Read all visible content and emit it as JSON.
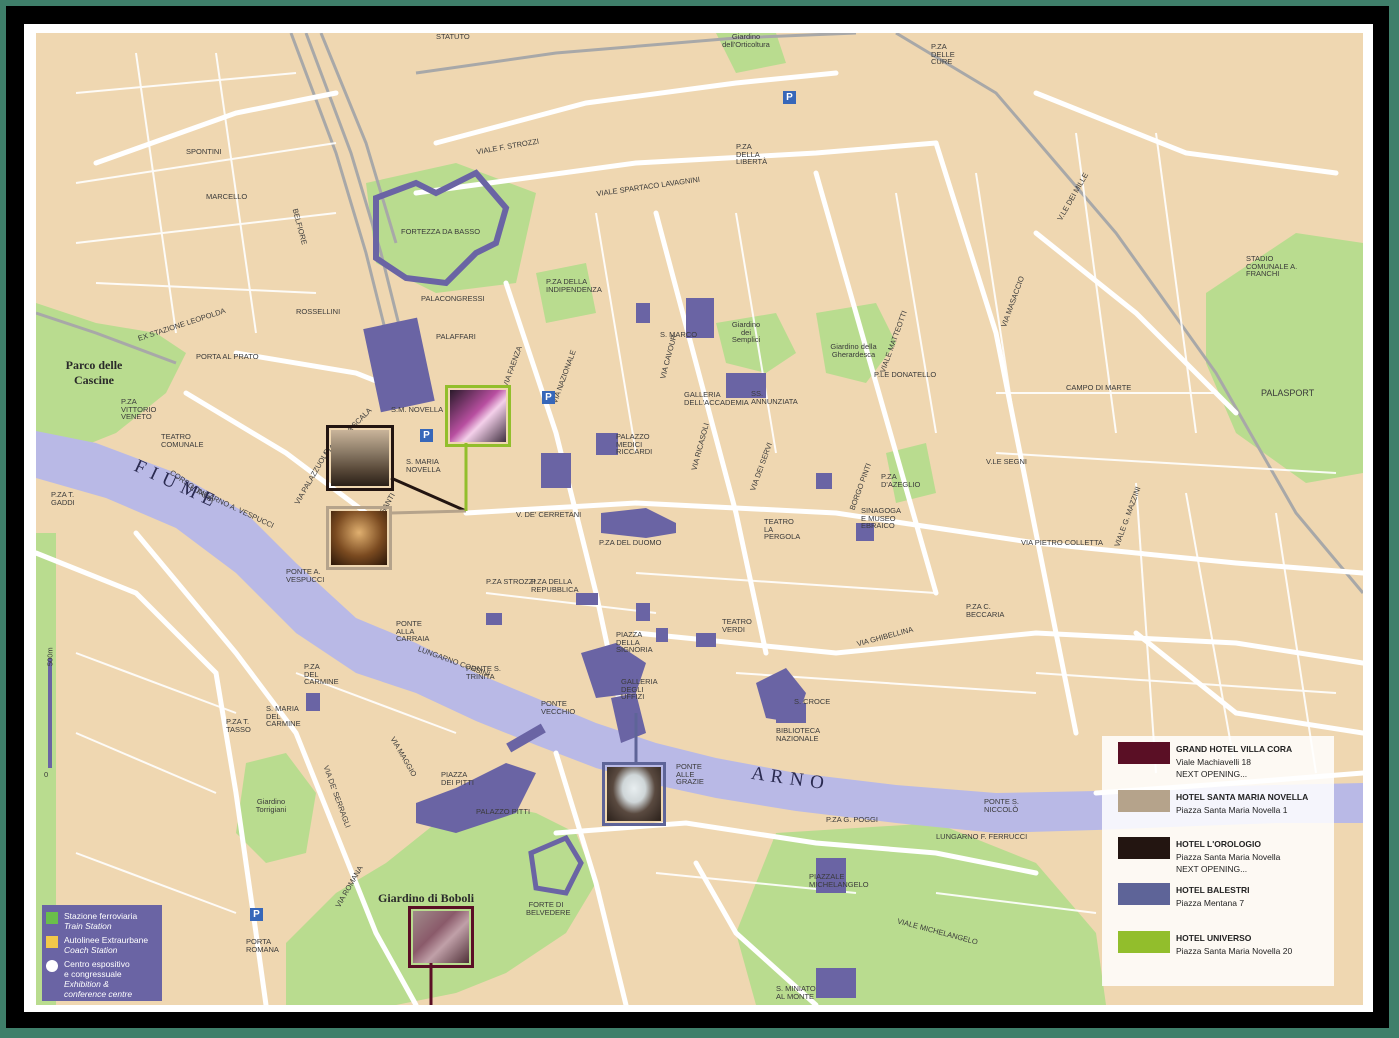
{
  "colors": {
    "background": "#3f7f6a",
    "map_base": "#efd7b1",
    "park": "#b9dc8f",
    "river": "#b9b9e6",
    "monument": "#6a64a4",
    "street": "#ffffff"
  },
  "labels": {
    "parco_cascine": "Parco delle Cascine",
    "stazione_leopolda": "EX STAZIONE LEOPOLDA",
    "fortezza": "FORTEZZA DA BASSO",
    "palacongressi": "PALACONGRESSI",
    "palaffari": "PALAFFARI",
    "giardino_semplici": "Giardino dei Semplici",
    "giardino_gherardesca": "Giardino della Gherardesca",
    "giardino_orticultura": "Giardino dell'Orticoltura",
    "campo_marte": "CAMPO DI MARTE",
    "palasport": "PALASPORT",
    "stadio": "STADIO COMUNALE A. FRANCHI",
    "giardino_boboli": "Giardino di Boboli",
    "giardino_torrigiani": "Giardino Torrigiani",
    "forte_belvedere": "FORTE DI BELVEDERE",
    "palazzo_pitti": "PALAZZO PITTI",
    "piazza_pitti": "PIAZZA DEI PITTI",
    "ponte_vecchio": "PONTE VECCHIO",
    "ponte_trinita": "PONTE S. TRINITA",
    "ponte_carraia": "PONTE ALLA CARRAIA",
    "ponte_vespucci": "PONTE A. VESPUCCI",
    "ponte_grazie": "PONTE ALLE GRAZIE",
    "ponte_niccolo": "PONTE S. NICCOLÒ",
    "piazzale_michelangelo": "PIAZZALE MICHELANGELO",
    "santa_croce": "S. CROCE",
    "biblioteca": "BIBLIOTECA NAZIONALE",
    "piazza_signoria": "PIAZZA DELLA SIGNORIA",
    "galleria_uffizi": "GALLERIA DEGLI UFFIZI",
    "palazzo_medici": "PALAZZO MEDICI RICCARDI",
    "piazza_duomo": "P.ZA DEL DUOMO",
    "piazza_sm_novella": "S. MARIA NOVELLA",
    "sm_novella_station": "S.M. NOVELLA",
    "ss_annunziata": "SS. ANNUNZIATA",
    "teatro_pergola": "TEATRO LA PERGOLA",
    "teatro_verdi": "TEATRO VERDI",
    "teatro_comunale": "TEATRO COMUNALE",
    "sinagoga": "SINAGOGA E MUSEO EBRAICO",
    "galleria_accademia": "GALLERIA DELL'ACCADEMIA",
    "san_marco": "S. MARCO",
    "piazza_liberta": "P.ZA DELLA LIBERTÀ",
    "piazza_indipendenza": "P.ZA DELLA INDIPENDENZA",
    "piazza_azeglio": "P.ZA D'AZEGLIO",
    "piazza_carmine": "P.ZA DEL CARMINE",
    "sm_carmine": "S. MARIA DEL CARMINE",
    "piazza_vittorio_veneto": "P.ZA VITTORIO VENETO",
    "porta_prato": "PORTA AL PRATO",
    "porta_romana": "PORTA ROMANA",
    "statuto": "STATUTO",
    "viale_lavagnini": "VIALE SPARTACO LAVAGNINI",
    "viale_strozzi": "VIALE F. STROZZI",
    "lungarno_vespucci": "LUNGARNO A. VESPUCCI",
    "lungarno_corsini": "LUNGARNO CORSINI",
    "lungarno_ferrucci": "LUNGARNO F. FERRUCCI",
    "via_cerretani": "V. DE' CERRETANI",
    "piazza_strozzi": "P.ZA STROZZI",
    "piazza_repubblica": "P.ZA DELLA REPUBBLICA",
    "san_miniato": "S. MINIATO AL MONTE",
    "viale_michelangelo": "VIALE MICHELANGELO",
    "rossellini": "ROSSELLINI",
    "spontini": "SPONTINI",
    "marcello": "MARCELLO",
    "belfiore": "BELFIORE",
    "corso_italia": "CORSO ITALIA",
    "via_palazzuolo": "VIA PALAZZUOLO",
    "borgo_ognissanti": "BORGO OGNISSANTI",
    "via_della_scala": "VIA DELLA SCALA",
    "via_faenza": "VIA FAENZA",
    "via_nazionale": "VIA NAZIONALE",
    "via_cavour": "VIA CAVOUR",
    "via_ricasoli": "VIA RICASOLI",
    "via_servi": "VIA DEI SERVI",
    "borgo_pinti": "BORGO PINTI",
    "via_ghibellina": "VIA GHIBELLINA",
    "via_colletta": "VIA PIETRO COLLETTA",
    "viale_mazzini": "VIALE G. MAZZINI",
    "viale_matteotti": "VIALE MATTEOTTI",
    "via_masaccio": "VIA MASACCIO",
    "via_stibbert": "VIA FAENZA",
    "p_beccaria": "P.ZA C. BECCARIA",
    "p_donatello": "P.LE DONATELLO",
    "via_vittorio": "V.LE DEI MILLE",
    "viale_segni": "V.LE SEGNI",
    "p_gaddi": "P.ZA T. GADDI",
    "p_tasso": "P.ZA T. TASSO",
    "via_serragli": "VIA DE' SERRAGLI",
    "via_romana": "VIA ROMANA",
    "via_maggio": "VIA MAGGIO",
    "piazza_poggi": "P.ZA G. POGGI",
    "p_cavour": "P.ZA DELLE CURE",
    "scale_500": "500m",
    "scale_0": "0"
  },
  "river": {
    "fiume": "F I U M E",
    "arno": "A R N O"
  },
  "station_legend": {
    "train_it": "Stazione ferroviaria",
    "train_en": "Train Station",
    "coach_it": "Autolinee Extraurbane",
    "coach_en": "Coach Station",
    "expo_it1": "Centro espositivo",
    "expo_it2": "e congressuale",
    "expo_en1": "Exhibition &",
    "expo_en2": "conference centre"
  },
  "hotels": [
    {
      "name": "GRAND HOTEL VILLA CORA",
      "address": "Viale Machiavelli 18",
      "note": "NEXT OPENING...",
      "color": "#5a0f25"
    },
    {
      "name": "HOTEL SANTA MARIA NOVELLA",
      "address": "Piazza Santa Maria Novella 1",
      "note": "",
      "color": "#b5a38b"
    },
    {
      "name": "HOTEL L'OROLOGIO",
      "address": "Piazza Santa Maria Novella",
      "note": "NEXT OPENING...",
      "color": "#231511"
    },
    {
      "name": "HOTEL BALESTRI",
      "address": "Piazza Mentana 7",
      "note": "",
      "color": "#5e6498"
    },
    {
      "name": "HOTEL UNIVERSO",
      "address": "Piazza Santa Maria Novella 20",
      "note": "",
      "color": "#92be2c"
    }
  ],
  "parking_label": "P"
}
